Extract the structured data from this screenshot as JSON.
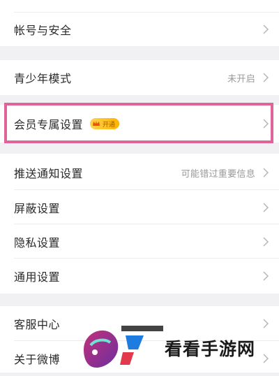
{
  "settings": {
    "account_security": "帐号与安全",
    "youth_mode": {
      "label": "青少年模式",
      "value": "未开启"
    },
    "vip_settings": {
      "label": "会员专属设置",
      "badge": "开通"
    },
    "push_settings": {
      "label": "推送通知设置",
      "value": "可能错过重要信息"
    },
    "block_settings": "屏蔽设置",
    "privacy_settings": "隐私设置",
    "general_settings": "通用设置",
    "customer_service": "客服中心",
    "about": "关于微博"
  },
  "watermark": {
    "text": "看看手游网"
  },
  "colors": {
    "highlight": "#e0649a",
    "background": "#f1f1f3",
    "badge": "#ffc21a"
  }
}
